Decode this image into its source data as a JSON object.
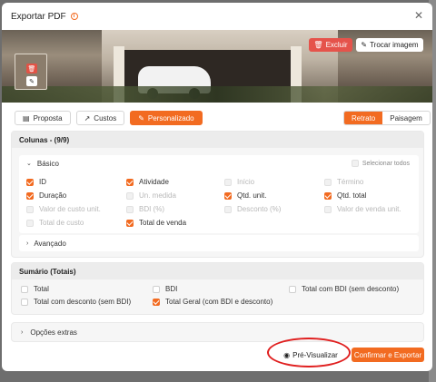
{
  "modal": {
    "title": "Exportar PDF",
    "info_icon": "info-circle-icon",
    "close_icon": "close-icon"
  },
  "cover": {
    "delete_label": "Excluir",
    "change_label": "Trocar imagem",
    "thumb_delete_icon": "trash-icon",
    "thumb_edit_icon": "pencil-icon"
  },
  "tabs": [
    {
      "label": "Proposta",
      "icon": "document-icon",
      "active": false
    },
    {
      "label": "Custos",
      "icon": "chart-line-icon",
      "active": false
    },
    {
      "label": "Personalizado",
      "icon": "pencil-icon",
      "active": true
    }
  ],
  "orientation": {
    "portrait": "Retrato",
    "landscape": "Paisagem",
    "selected": "Retrato"
  },
  "columns": {
    "title": "Colunas - (9/9)",
    "basic_label": "Básico",
    "select_all_label": "Selecionar todos",
    "advanced_label": "Avançado",
    "options": [
      {
        "label": "ID",
        "state": "checked"
      },
      {
        "label": "Atividade",
        "state": "checked"
      },
      {
        "label": "Início",
        "state": "disabled"
      },
      {
        "label": "Término",
        "state": "disabled"
      },
      {
        "label": "Duração",
        "state": "checked"
      },
      {
        "label": "Un. medida",
        "state": "disabled"
      },
      {
        "label": "Qtd. unit.",
        "state": "checked"
      },
      {
        "label": "Qtd. total",
        "state": "checked"
      },
      {
        "label": "Valor de custo unit.",
        "state": "disabled"
      },
      {
        "label": "BDI (%)",
        "state": "disabled"
      },
      {
        "label": "Desconto (%)",
        "state": "disabled"
      },
      {
        "label": "Valor de venda unit.",
        "state": "disabled"
      },
      {
        "label": "Total de custo",
        "state": "disabled"
      },
      {
        "label": "Total de venda",
        "state": "checked"
      }
    ]
  },
  "summary": {
    "title": "Sumário (Totais)",
    "options": [
      {
        "label": "Total",
        "state": "unchecked"
      },
      {
        "label": "BDI",
        "state": "unchecked"
      },
      {
        "label": "Total com BDI (sem desconto)",
        "state": "unchecked"
      },
      {
        "label": "Total com desconto (sem BDI)",
        "state": "unchecked"
      },
      {
        "label": "Total Geral (com BDI e desconto)",
        "state": "checked"
      }
    ]
  },
  "extras_label": "Opções extras",
  "footer": {
    "preview_label": "Pré-Visualizar",
    "preview_icon": "eye-icon",
    "confirm_label": "Confirmar e Exportar"
  },
  "colors": {
    "accent": "#f26b21",
    "danger": "#e5534b",
    "annotation": "#e02020"
  }
}
